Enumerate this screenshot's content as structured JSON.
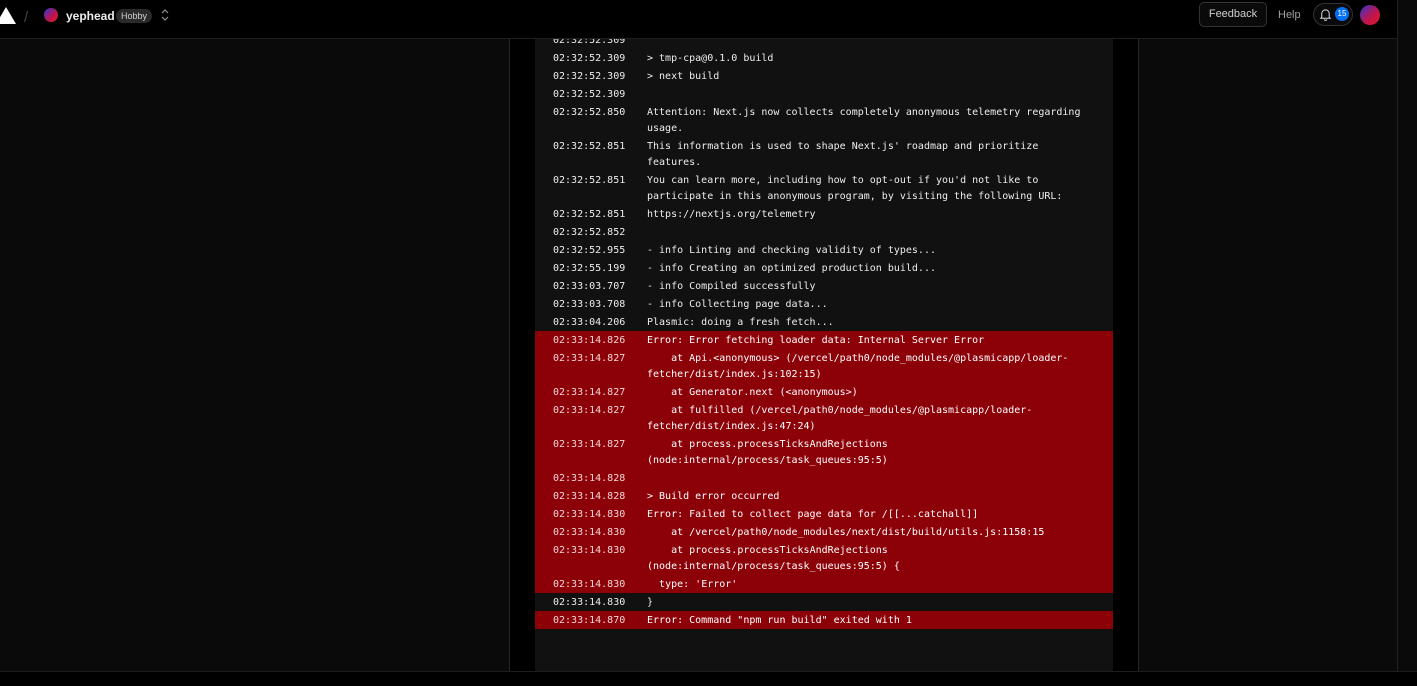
{
  "header": {
    "team_name": "yephead",
    "plan_badge": "Hobby",
    "feedback_label": "Feedback",
    "help_label": "Help",
    "notification_count": "15",
    "icons": [
      "vercel-logo-icon",
      "chevron-up-down-icon",
      "bell-icon"
    ]
  },
  "colors": {
    "error_row": "#8c0008",
    "log_background": "#111111",
    "badge_blue": "#0070f3"
  },
  "logs": [
    {
      "time": "02:32:52.309",
      "message": "",
      "error": false
    },
    {
      "time": "02:32:52.309",
      "message": "> tmp-cpa@0.1.0 build",
      "error": false
    },
    {
      "time": "02:32:52.309",
      "message": "> next build",
      "error": false
    },
    {
      "time": "02:32:52.309",
      "message": "",
      "error": false
    },
    {
      "time": "02:32:52.850",
      "message": "Attention: Next.js now collects completely anonymous telemetry regarding usage.",
      "error": false
    },
    {
      "time": "02:32:52.851",
      "message": "This information is used to shape Next.js' roadmap and prioritize features.",
      "error": false
    },
    {
      "time": "02:32:52.851",
      "message": "You can learn more, including how to opt-out if you'd not like to participate in this anonymous program, by visiting the following URL:",
      "error": false
    },
    {
      "time": "02:32:52.851",
      "message": "https://nextjs.org/telemetry",
      "error": false
    },
    {
      "time": "02:32:52.852",
      "message": "",
      "error": false
    },
    {
      "time": "02:32:52.955",
      "message": "- info Linting and checking validity of types...",
      "error": false
    },
    {
      "time": "02:32:55.199",
      "message": "- info Creating an optimized production build...",
      "error": false
    },
    {
      "time": "02:33:03.707",
      "message": "- info Compiled successfully",
      "error": false
    },
    {
      "time": "02:33:03.708",
      "message": "- info Collecting page data...",
      "error": false
    },
    {
      "time": "02:33:04.206",
      "message": "Plasmic: doing a fresh fetch...",
      "error": false
    },
    {
      "time": "02:33:14.826",
      "message": "Error: Error fetching loader data: Internal Server Error",
      "error": true
    },
    {
      "time": "02:33:14.827",
      "message": "    at Api.<anonymous> (/vercel/path0/node_modules/@plasmicapp/loader-fetcher/dist/index.js:102:15)",
      "error": true
    },
    {
      "time": "02:33:14.827",
      "message": "    at Generator.next (<anonymous>)",
      "error": true
    },
    {
      "time": "02:33:14.827",
      "message": "    at fulfilled (/vercel/path0/node_modules/@plasmicapp/loader-fetcher/dist/index.js:47:24)",
      "error": true
    },
    {
      "time": "02:33:14.827",
      "message": "    at process.processTicksAndRejections (node:internal/process/task_queues:95:5)",
      "error": true
    },
    {
      "time": "02:33:14.828",
      "message": "",
      "error": true
    },
    {
      "time": "02:33:14.828",
      "message": "> Build error occurred",
      "error": true
    },
    {
      "time": "02:33:14.830",
      "message": "Error: Failed to collect page data for /[[...catchall]]",
      "error": true
    },
    {
      "time": "02:33:14.830",
      "message": "    at /vercel/path0/node_modules/next/dist/build/utils.js:1158:15",
      "error": true
    },
    {
      "time": "02:33:14.830",
      "message": "    at process.processTicksAndRejections (node:internal/process/task_queues:95:5) {",
      "error": true
    },
    {
      "time": "02:33:14.830",
      "message": "  type: 'Error'",
      "error": true
    },
    {
      "time": "02:33:14.830",
      "message": "}",
      "error": false
    },
    {
      "time": "02:33:14.870",
      "message": "Error: Command \"npm run build\" exited with 1",
      "error": true
    }
  ]
}
